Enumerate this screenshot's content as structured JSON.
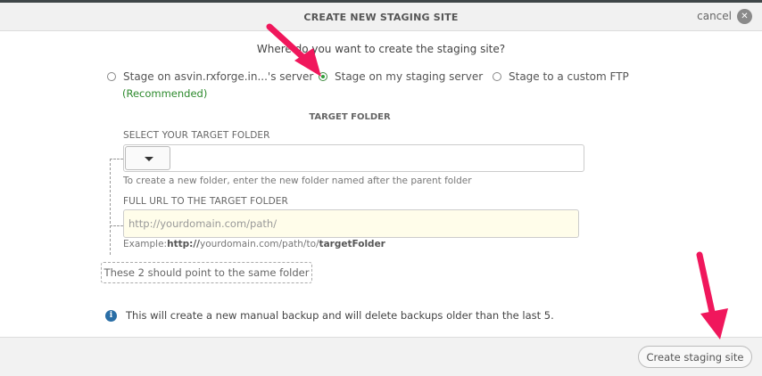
{
  "header": {
    "title": "CREATE NEW STAGING SITE",
    "cancel_label": "cancel",
    "close_glyph": "✕"
  },
  "question": "Where do you want to create the staging site?",
  "options": [
    {
      "label": "Stage on asvin.rxforge.in...'s server",
      "checked": false
    },
    {
      "label": "Stage on my staging server",
      "checked": true
    },
    {
      "label": "Stage to a custom FTP",
      "checked": false
    }
  ],
  "recommended_label": "(Recommended)",
  "target_folder": {
    "section_title": "TARGET FOLDER",
    "select_label": "SELECT YOUR TARGET FOLDER",
    "new_folder_hint": "To create a new folder, enter the new folder named after the parent folder",
    "url_label": "FULL URL TO THE TARGET FOLDER",
    "url_placeholder": "http://yourdomain.com/path/",
    "url_value": "",
    "example_prefix": "Example:",
    "example_bold1": "http://",
    "example_middle": "yourdomain.com/path/to/",
    "example_bold2": "targetFolder",
    "note": "These 2 should point to the same folder"
  },
  "info_text": "This will create a new manual backup and will delete backups older than the last 5.",
  "footer": {
    "create_label": "Create staging site"
  },
  "colors": {
    "accent_green": "#2f9e3a",
    "arrow_pink": "#f0175c",
    "info_blue": "#2a6ea6",
    "input_bg": "#fffdea"
  }
}
